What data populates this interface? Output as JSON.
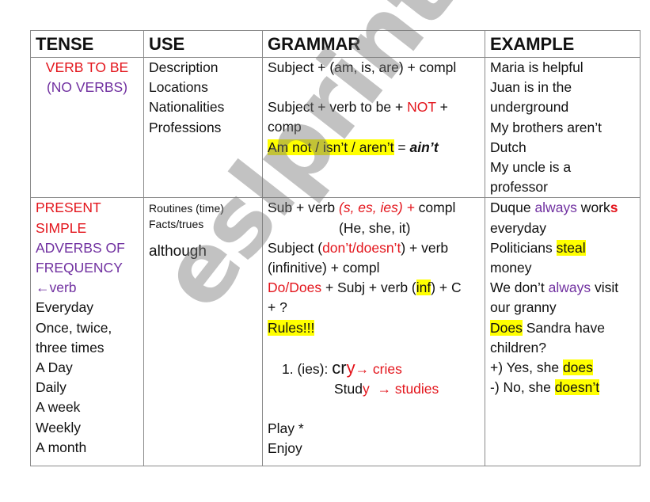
{
  "headers": [
    "TENSE",
    "USE",
    "GRAMMAR",
    "EXAMPLE"
  ],
  "row1": {
    "tense": [
      "VERB TO BE",
      "(NO VERBS)"
    ],
    "use": [
      "Description",
      "Locations",
      "Nationalities",
      "Professions"
    ],
    "grammar": {
      "line1": "Subject  + (am, is, are) + compl",
      "line2_pre": "Subject + verb to be + ",
      "line2_not": "NOT",
      "line2_post": " +",
      "line3": "comp",
      "line4_hl": "Am not  / isn’t / aren’t",
      "line4_eq": " = ",
      "line4_bi": "ain’t"
    },
    "example": [
      "Maria is helpful",
      "Juan is in the",
      "underground",
      "My brothers aren’t",
      "Dutch",
      "My uncle is a",
      "professor"
    ]
  },
  "row2": {
    "tense": {
      "red": [
        "PRESENT",
        "SIMPLE"
      ],
      "purple": [
        "ADVERBS OF",
        "FREQUENCY",
        "←verb"
      ],
      "black": [
        "Everyday",
        "Once, twice,",
        "three times",
        "A Day",
        "Daily",
        "A week",
        "Weekly",
        "A month"
      ]
    },
    "use": {
      "small": [
        "Routines (time)",
        "Facts/trues"
      ],
      "big": "although"
    },
    "grammar": {
      "l1_a": "Sub + verb ",
      "l1_b": "(s, es, ies) +",
      "l1_c": " compl",
      "l2": "(He, she, it)",
      "l3_a": "Subject (",
      "l3_b": "don’t/doesn’t",
      "l3_c": ") + verb",
      "l4": "(infinitive) + compl",
      "l5_a": "Do/Does",
      "l5_b": " + Subj + verb (",
      "l5_c": "inf",
      "l5_d": ") + C",
      "l6": "+ ?",
      "l7": "Rules!!!",
      "rule_num": "1.",
      "rule_label": "(ies): ",
      "rule1_cr": "cr",
      "rule1_y": "y",
      "rule1_arrow": "→ cries",
      "rule2_stud": "Stud",
      "rule2_y": "y",
      "rule2_arrow": "  → studies",
      "l8": "Play  *",
      "l9": "Enjoy"
    },
    "example": {
      "e1_a": "Duque ",
      "e1_b": "always",
      "e1_c": " work",
      "e1_d": "s",
      "e2": "everyday",
      "e3_a": "Politicians ",
      "e3_b": "steal",
      "e4": "money",
      "e5_a": "We don’t ",
      "e5_b": "always",
      "e5_c": " visit",
      "e6": "our granny",
      "e7_a": "Does",
      "e7_b": " Sandra have",
      "e8": "children?",
      "e9_a": "+) Yes, she ",
      "e9_b": "does",
      "e10_a": "-) No, she ",
      "e10_b": "doesn’t"
    }
  },
  "watermark": "eslprintables.com",
  "colors": {
    "red": "#e3151c",
    "purple": "#7030a0",
    "highlight": "#ffff00",
    "border": "#8a8a8a"
  }
}
